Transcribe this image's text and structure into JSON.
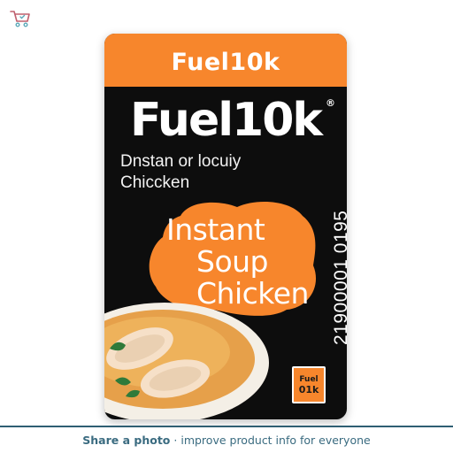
{
  "header": {
    "cart_icon": "shopping-cart-icon"
  },
  "product": {
    "top_band_text": "Fuel10k",
    "brand_text": "Fuel10k",
    "registered_mark": "®",
    "subtitle_line1": "Dnstan or locuiy",
    "subtitle_line2": "Chiccken",
    "name_lines": [
      "Instant",
      "Soup",
      "Chicken"
    ],
    "side_number": "21900001 0195",
    "mini_logo_line1": "Fuel",
    "mini_logo_line2": "01k",
    "colors": {
      "accent_orange": "#f7862c",
      "box_black": "#0d0d0d",
      "footer_text": "#3a6b80"
    }
  },
  "footer": {
    "cta_bold": "Share a photo",
    "cta_rest": "· improve product info for everyone"
  }
}
